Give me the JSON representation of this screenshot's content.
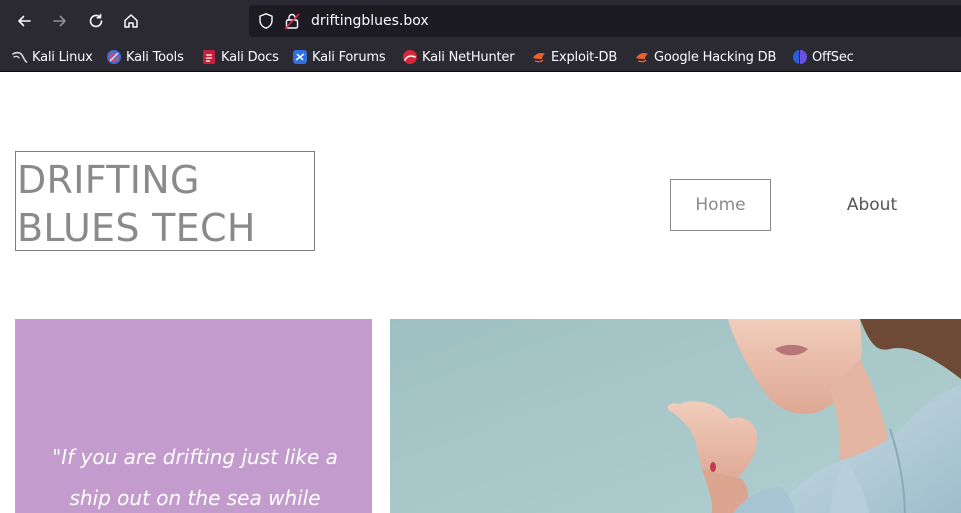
{
  "browser": {
    "url": "driftingblues.box",
    "bookmarks": [
      {
        "label": "Kali Linux",
        "icon": "kali-dragon-icon"
      },
      {
        "label": "Kali Tools",
        "icon": "kali-tools-icon"
      },
      {
        "label": "Kali Docs",
        "icon": "kali-docs-icon"
      },
      {
        "label": "Kali Forums",
        "icon": "kali-forums-icon"
      },
      {
        "label": "Kali NetHunter",
        "icon": "kali-nethunter-icon"
      },
      {
        "label": "Exploit-DB",
        "icon": "exploit-db-icon"
      },
      {
        "label": "Google Hacking DB",
        "icon": "google-hacking-db-icon"
      },
      {
        "label": "OffSec",
        "icon": "offsec-icon"
      }
    ]
  },
  "site": {
    "logo_line1": "DRIFTING",
    "logo_line2": "BLUES TECH",
    "nav": {
      "home": "Home",
      "about": "About"
    },
    "quote": "\"If you are drifting just like a ship out on the sea while"
  },
  "colors": {
    "quote_panel": "#c39bcd",
    "hero_background": "#a6c5c7",
    "chrome": "#2b2a33",
    "urlbar": "#1c1b22"
  }
}
